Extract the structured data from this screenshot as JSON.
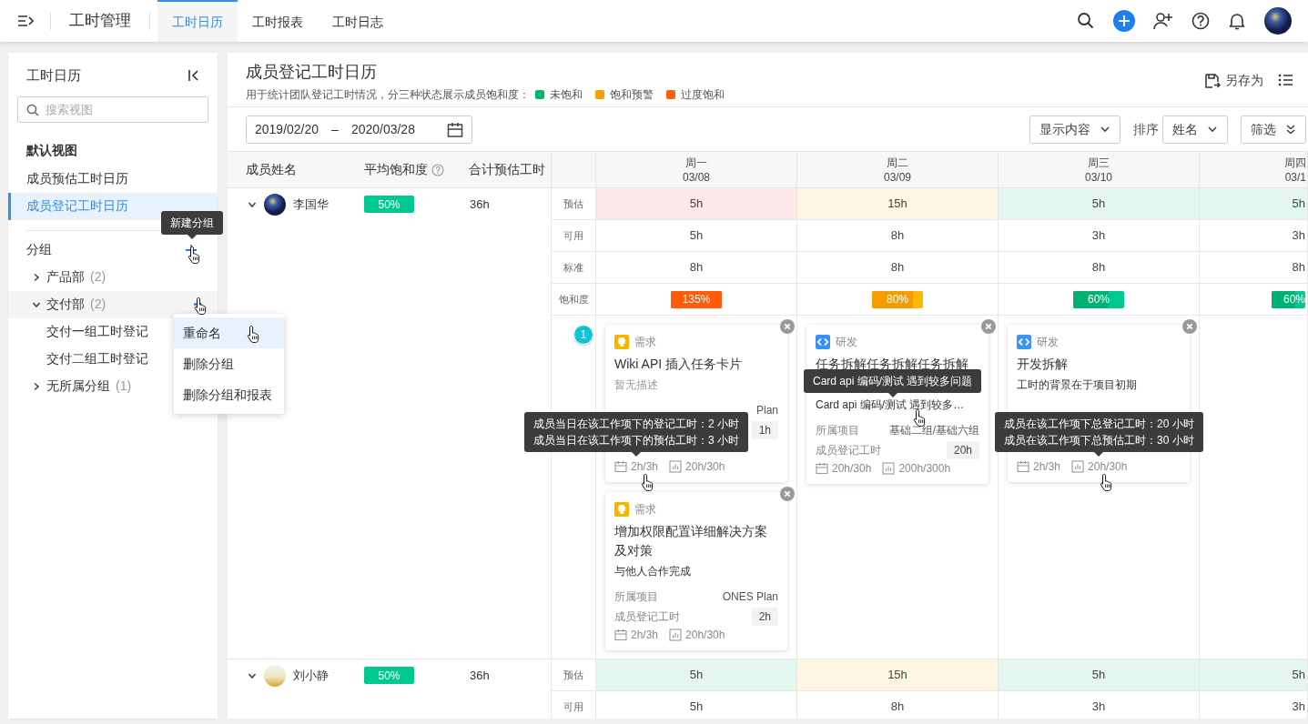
{
  "topbar": {
    "app_title": "工时管理",
    "tabs": [
      {
        "label": "工时日历",
        "selected": true
      },
      {
        "label": "工时报表",
        "selected": false
      },
      {
        "label": "工时日志",
        "selected": false
      }
    ]
  },
  "sidebar": {
    "title": "工时日历",
    "search": {
      "placeholder": "搜索视图"
    },
    "default_section": "默认视图",
    "views": [
      {
        "label": "成员预估工时日历",
        "selected": false
      },
      {
        "label": "成员登记工时日历",
        "selected": true
      }
    ],
    "group_section": "分组",
    "new_group_tooltip": "新建分组",
    "groups": [
      {
        "label": "产品部",
        "count": "(2)",
        "expanded": false,
        "hovered": false
      },
      {
        "label": "交付部",
        "count": "(2)",
        "expanded": true,
        "hovered": true,
        "children": [
          {
            "label": "交付一组工时登记"
          },
          {
            "label": "交付二组工时登记"
          }
        ]
      },
      {
        "label": "无所属分组",
        "count": "(1)",
        "expanded": false,
        "hovered": false
      }
    ],
    "context_menu": [
      {
        "label": "重命名",
        "selected": true
      },
      {
        "label": "删除分组",
        "selected": false
      },
      {
        "label": "删除分组和报表",
        "selected": false
      }
    ]
  },
  "header": {
    "title": "成员登记工时日历",
    "subtitle": "用于统计团队登记工时情况，分三种状态展示成员饱和度：",
    "legend": [
      {
        "label": "未饱和",
        "color": "#00b96b"
      },
      {
        "label": "饱和预警",
        "color": "#f5a300"
      },
      {
        "label": "过度饱和",
        "color": "#ff6005"
      }
    ],
    "save_as": "另存为"
  },
  "toolbar": {
    "date_start": "2019/02/20",
    "date_sep": "–",
    "date_end": "2020/03/28",
    "display": "显示内容",
    "sort_label": "排序",
    "sort_value": "姓名",
    "filter": "筛选"
  },
  "table": {
    "columns": [
      "成员姓名",
      "平均饱和度",
      "合计预估工时"
    ],
    "days": [
      {
        "weekday": "周一",
        "date": "03/08"
      },
      {
        "weekday": "周二",
        "date": "03/09"
      },
      {
        "weekday": "周三",
        "date": "03/10"
      },
      {
        "weekday": "周四",
        "date": "03/1"
      }
    ],
    "members": [
      {
        "name": "李国华",
        "expanded": true,
        "avg": {
          "text": "50%",
          "kind": "under"
        },
        "total": "36h",
        "rows": [
          {
            "label": "预估",
            "kind": "estimate",
            "cells": [
              {
                "text": "5h",
                "kind": "over"
              },
              {
                "text": "15h",
                "kind": "warn"
              },
              {
                "text": "5h",
                "kind": "under"
              },
              {
                "text": "5h",
                "kind": "under"
              }
            ]
          },
          {
            "label": "可用",
            "kind": "plain",
            "cells": [
              {
                "text": "5h"
              },
              {
                "text": "8h"
              },
              {
                "text": "3h"
              },
              {
                "text": "3h"
              }
            ]
          },
          {
            "label": "标准",
            "kind": "plain",
            "cells": [
              {
                "text": "8h"
              },
              {
                "text": "8h"
              },
              {
                "text": "8h"
              },
              {
                "text": "8h"
              }
            ]
          },
          {
            "label": "饱和度",
            "kind": "saturation",
            "cells": [
              {
                "text": "135%",
                "kind": "over",
                "level": 1
              },
              {
                "text": "80%",
                "kind": "warn",
                "level": 0.8
              },
              {
                "text": "60%",
                "kind": "under",
                "level": 0.7
              },
              {
                "text": "60%",
                "kind": "under",
                "level": 0.7
              }
            ]
          }
        ],
        "card_count": "1",
        "card_columns": [
          [
            {
              "kind": "requirement",
              "type": "需求",
              "title": "Wiki API 插入任务卡片",
              "desc": "暂无描述",
              "desc_muted": true,
              "rows": [
                {
                  "value": "Plan",
                  "kind": "text"
                },
                {
                  "value": "1h",
                  "kind": "badge"
                }
              ],
              "day": "2h/3h",
              "total": "20h/30h",
              "tooltip": {
                "kind": "day",
                "lines": [
                  "成员当日在该工作项下的登记工时：2 小时",
                  "成员当日在该工作项下的预估工时：3 小时"
                ]
              }
            },
            {
              "kind": "requirement",
              "type": "需求",
              "title": "增加权限配置详细解决方案及对策",
              "desc": "与他人合作完成",
              "desc_muted": false,
              "rows": [
                {
                  "label": "所属项目",
                  "value": "ONES Plan",
                  "kind": "text"
                },
                {
                  "label": "成员登记工时",
                  "value": "2h",
                  "kind": "badge"
                }
              ],
              "day": "2h/3h",
              "total": "20h/30h"
            }
          ],
          [
            {
              "kind": "dev",
              "type": "研发",
              "title": "任务拆解任务拆解任务拆解",
              "desc": "Card api 编码/测试 遇到较多…",
              "desc_muted": false,
              "rows": [
                {
                  "label": "所属项目",
                  "value": "基础二组/基础六组",
                  "kind": "text"
                },
                {
                  "label": "成员登记工时",
                  "value": "20h",
                  "kind": "badge"
                }
              ],
              "day": "20h/30h",
              "total": "200h/300h",
              "tooltip": {
                "kind": "title",
                "lines": [
                  "Card api 编码/测试 遇到较多问题"
                ]
              }
            }
          ],
          [
            {
              "kind": "dev",
              "type": "研发",
              "title": "开发拆解",
              "desc": "工时的背景在于项目初期",
              "desc_muted": false,
              "day": "2h/3h",
              "total": "20h/30h",
              "tooltip": {
                "kind": "total",
                "lines": [
                  "成员在该工作项下总登记工时：20 小时",
                  "成员在该工作项下总预估工时：30 小时"
                ]
              }
            }
          ],
          []
        ]
      },
      {
        "name": "刘小静",
        "expanded": true,
        "avg": {
          "text": "50%",
          "kind": "under"
        },
        "total": "36h",
        "rows": [
          {
            "label": "预估",
            "kind": "estimate",
            "cells": [
              {
                "text": "5h",
                "kind": "under"
              },
              {
                "text": "15h",
                "kind": "warn"
              },
              {
                "text": "5h",
                "kind": "under"
              },
              {
                "text": "5h",
                "kind": "under"
              }
            ]
          },
          {
            "label": "可用",
            "kind": "plain",
            "cells": [
              {
                "text": "5h"
              },
              {
                "text": "8h"
              },
              {
                "text": "3h"
              },
              {
                "text": "3h"
              }
            ]
          }
        ]
      }
    ]
  }
}
